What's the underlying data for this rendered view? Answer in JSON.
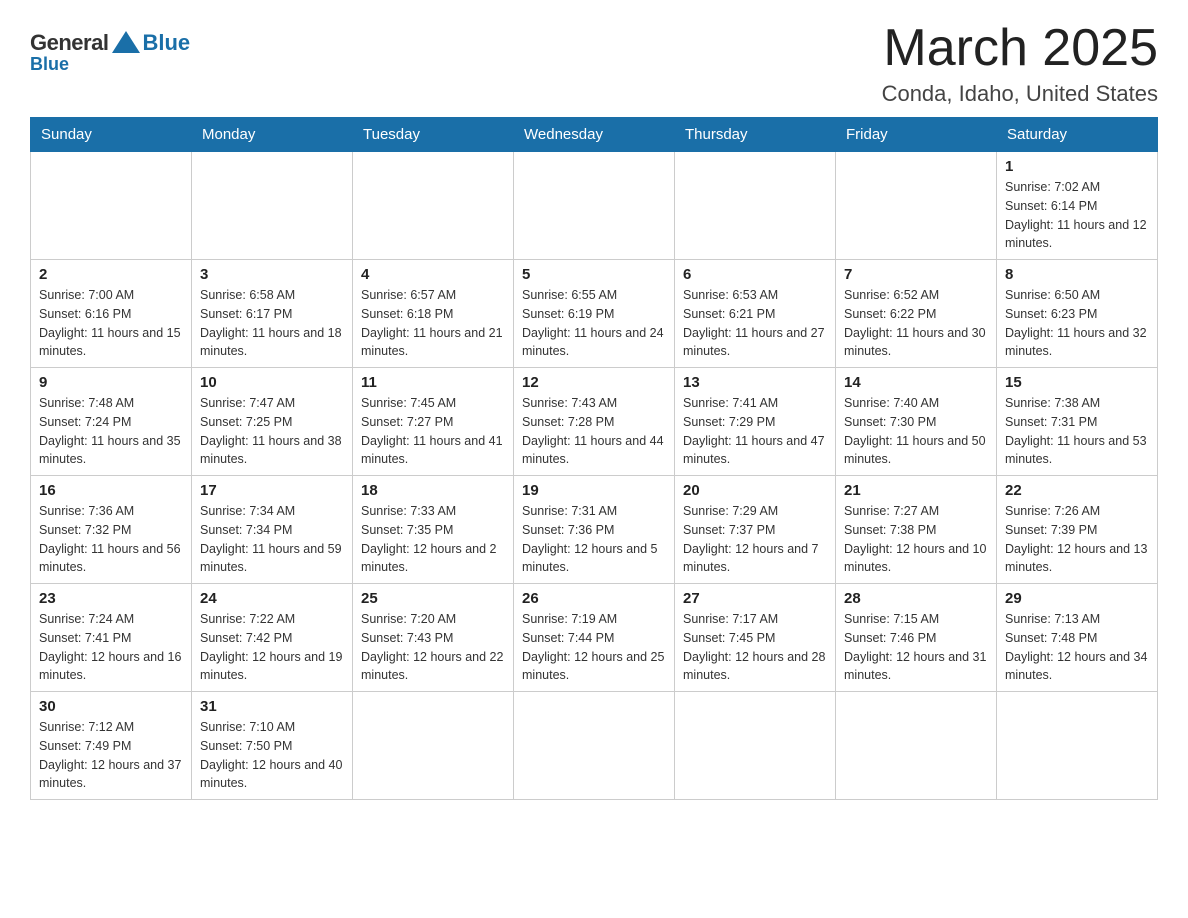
{
  "header": {
    "logo_general": "General",
    "logo_blue": "Blue",
    "month_title": "March 2025",
    "location": "Conda, Idaho, United States"
  },
  "calendar": {
    "days_of_week": [
      "Sunday",
      "Monday",
      "Tuesday",
      "Wednesday",
      "Thursday",
      "Friday",
      "Saturday"
    ],
    "weeks": [
      [
        {
          "day": "",
          "info": ""
        },
        {
          "day": "",
          "info": ""
        },
        {
          "day": "",
          "info": ""
        },
        {
          "day": "",
          "info": ""
        },
        {
          "day": "",
          "info": ""
        },
        {
          "day": "",
          "info": ""
        },
        {
          "day": "1",
          "info": "Sunrise: 7:02 AM\nSunset: 6:14 PM\nDaylight: 11 hours and 12 minutes."
        }
      ],
      [
        {
          "day": "2",
          "info": "Sunrise: 7:00 AM\nSunset: 6:16 PM\nDaylight: 11 hours and 15 minutes."
        },
        {
          "day": "3",
          "info": "Sunrise: 6:58 AM\nSunset: 6:17 PM\nDaylight: 11 hours and 18 minutes."
        },
        {
          "day": "4",
          "info": "Sunrise: 6:57 AM\nSunset: 6:18 PM\nDaylight: 11 hours and 21 minutes."
        },
        {
          "day": "5",
          "info": "Sunrise: 6:55 AM\nSunset: 6:19 PM\nDaylight: 11 hours and 24 minutes."
        },
        {
          "day": "6",
          "info": "Sunrise: 6:53 AM\nSunset: 6:21 PM\nDaylight: 11 hours and 27 minutes."
        },
        {
          "day": "7",
          "info": "Sunrise: 6:52 AM\nSunset: 6:22 PM\nDaylight: 11 hours and 30 minutes."
        },
        {
          "day": "8",
          "info": "Sunrise: 6:50 AM\nSunset: 6:23 PM\nDaylight: 11 hours and 32 minutes."
        }
      ],
      [
        {
          "day": "9",
          "info": "Sunrise: 7:48 AM\nSunset: 7:24 PM\nDaylight: 11 hours and 35 minutes."
        },
        {
          "day": "10",
          "info": "Sunrise: 7:47 AM\nSunset: 7:25 PM\nDaylight: 11 hours and 38 minutes."
        },
        {
          "day": "11",
          "info": "Sunrise: 7:45 AM\nSunset: 7:27 PM\nDaylight: 11 hours and 41 minutes."
        },
        {
          "day": "12",
          "info": "Sunrise: 7:43 AM\nSunset: 7:28 PM\nDaylight: 11 hours and 44 minutes."
        },
        {
          "day": "13",
          "info": "Sunrise: 7:41 AM\nSunset: 7:29 PM\nDaylight: 11 hours and 47 minutes."
        },
        {
          "day": "14",
          "info": "Sunrise: 7:40 AM\nSunset: 7:30 PM\nDaylight: 11 hours and 50 minutes."
        },
        {
          "day": "15",
          "info": "Sunrise: 7:38 AM\nSunset: 7:31 PM\nDaylight: 11 hours and 53 minutes."
        }
      ],
      [
        {
          "day": "16",
          "info": "Sunrise: 7:36 AM\nSunset: 7:32 PM\nDaylight: 11 hours and 56 minutes."
        },
        {
          "day": "17",
          "info": "Sunrise: 7:34 AM\nSunset: 7:34 PM\nDaylight: 11 hours and 59 minutes."
        },
        {
          "day": "18",
          "info": "Sunrise: 7:33 AM\nSunset: 7:35 PM\nDaylight: 12 hours and 2 minutes."
        },
        {
          "day": "19",
          "info": "Sunrise: 7:31 AM\nSunset: 7:36 PM\nDaylight: 12 hours and 5 minutes."
        },
        {
          "day": "20",
          "info": "Sunrise: 7:29 AM\nSunset: 7:37 PM\nDaylight: 12 hours and 7 minutes."
        },
        {
          "day": "21",
          "info": "Sunrise: 7:27 AM\nSunset: 7:38 PM\nDaylight: 12 hours and 10 minutes."
        },
        {
          "day": "22",
          "info": "Sunrise: 7:26 AM\nSunset: 7:39 PM\nDaylight: 12 hours and 13 minutes."
        }
      ],
      [
        {
          "day": "23",
          "info": "Sunrise: 7:24 AM\nSunset: 7:41 PM\nDaylight: 12 hours and 16 minutes."
        },
        {
          "day": "24",
          "info": "Sunrise: 7:22 AM\nSunset: 7:42 PM\nDaylight: 12 hours and 19 minutes."
        },
        {
          "day": "25",
          "info": "Sunrise: 7:20 AM\nSunset: 7:43 PM\nDaylight: 12 hours and 22 minutes."
        },
        {
          "day": "26",
          "info": "Sunrise: 7:19 AM\nSunset: 7:44 PM\nDaylight: 12 hours and 25 minutes."
        },
        {
          "day": "27",
          "info": "Sunrise: 7:17 AM\nSunset: 7:45 PM\nDaylight: 12 hours and 28 minutes."
        },
        {
          "day": "28",
          "info": "Sunrise: 7:15 AM\nSunset: 7:46 PM\nDaylight: 12 hours and 31 minutes."
        },
        {
          "day": "29",
          "info": "Sunrise: 7:13 AM\nSunset: 7:48 PM\nDaylight: 12 hours and 34 minutes."
        }
      ],
      [
        {
          "day": "30",
          "info": "Sunrise: 7:12 AM\nSunset: 7:49 PM\nDaylight: 12 hours and 37 minutes."
        },
        {
          "day": "31",
          "info": "Sunrise: 7:10 AM\nSunset: 7:50 PM\nDaylight: 12 hours and 40 minutes."
        },
        {
          "day": "",
          "info": ""
        },
        {
          "day": "",
          "info": ""
        },
        {
          "day": "",
          "info": ""
        },
        {
          "day": "",
          "info": ""
        },
        {
          "day": "",
          "info": ""
        }
      ]
    ]
  }
}
